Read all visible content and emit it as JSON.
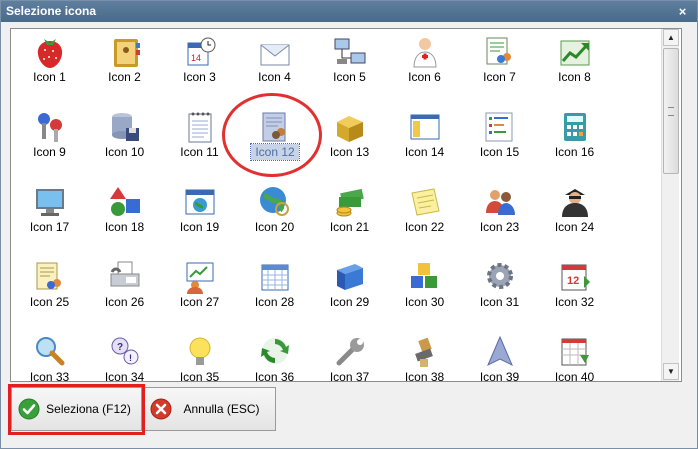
{
  "window": {
    "title": "Selezione icona",
    "close_glyph": "×"
  },
  "grid": {
    "selected": "Icon 12",
    "items": [
      {
        "label": "Icon 1",
        "icon": "strawberry-icon"
      },
      {
        "label": "Icon 2",
        "icon": "address-book-icon"
      },
      {
        "label": "Icon 3",
        "icon": "calendar-clock-icon"
      },
      {
        "label": "Icon 4",
        "icon": "envelope-icon"
      },
      {
        "label": "Icon 5",
        "icon": "network-icon"
      },
      {
        "label": "Icon 6",
        "icon": "doctor-icon"
      },
      {
        "label": "Icon 7",
        "icon": "user-report-icon"
      },
      {
        "label": "Icon 8",
        "icon": "chart-icon"
      },
      {
        "label": "Icon 9",
        "icon": "keys-icon"
      },
      {
        "label": "Icon 10",
        "icon": "database-save-icon"
      },
      {
        "label": "Icon 11",
        "icon": "notepad-icon"
      },
      {
        "label": "Icon 12",
        "icon": "document-users-icon"
      },
      {
        "label": "Icon 13",
        "icon": "boxes-icon"
      },
      {
        "label": "Icon 14",
        "icon": "window-layout-icon"
      },
      {
        "label": "Icon 15",
        "icon": "list-tree-icon"
      },
      {
        "label": "Icon 16",
        "icon": "calculator-icon"
      },
      {
        "label": "Icon 17",
        "icon": "monitor-icon"
      },
      {
        "label": "Icon 18",
        "icon": "shapes-icon"
      },
      {
        "label": "Icon 19",
        "icon": "browser-globe-icon"
      },
      {
        "label": "Icon 20",
        "icon": "globe-search-icon"
      },
      {
        "label": "Icon 21",
        "icon": "money-icon"
      },
      {
        "label": "Icon 22",
        "icon": "note-icon"
      },
      {
        "label": "Icon 23",
        "icon": "users-icon"
      },
      {
        "label": "Icon 24",
        "icon": "spy-icon"
      },
      {
        "label": "Icon 25",
        "icon": "contacts-icon"
      },
      {
        "label": "Icon 26",
        "icon": "fax-icon"
      },
      {
        "label": "Icon 27",
        "icon": "presentation-icon"
      },
      {
        "label": "Icon 28",
        "icon": "calendar-grid-icon"
      },
      {
        "label": "Icon 29",
        "icon": "book-icon"
      },
      {
        "label": "Icon 30",
        "icon": "blocks-icon"
      },
      {
        "label": "Icon 31",
        "icon": "gear-icon"
      },
      {
        "label": "Icon 32",
        "icon": "calendar-edit-icon"
      },
      {
        "label": "Icon 33",
        "icon": "magnifier-icon"
      },
      {
        "label": "Icon 34",
        "icon": "help-chat-icon"
      },
      {
        "label": "Icon 35",
        "icon": "lightbulb-icon"
      },
      {
        "label": "Icon 36",
        "icon": "recycle-icon"
      },
      {
        "label": "Icon 37",
        "icon": "wrench-icon"
      },
      {
        "label": "Icon 38",
        "icon": "stamp-icon"
      },
      {
        "label": "Icon 39",
        "icon": "arrow-up-icon"
      },
      {
        "label": "Icon 40",
        "icon": "calendar-plan-icon"
      }
    ]
  },
  "buttons": {
    "select_label": "Seleziona (F12)",
    "cancel_label": "Annulla (ESC)"
  },
  "scrollbar": {
    "up_glyph": "▲",
    "down_glyph": "▼"
  },
  "colors": {
    "accent_ring": "#e03030",
    "titlebar": "#4f6f8f",
    "ok_green": "#3aa13a",
    "cancel_red": "#d43a2a"
  }
}
